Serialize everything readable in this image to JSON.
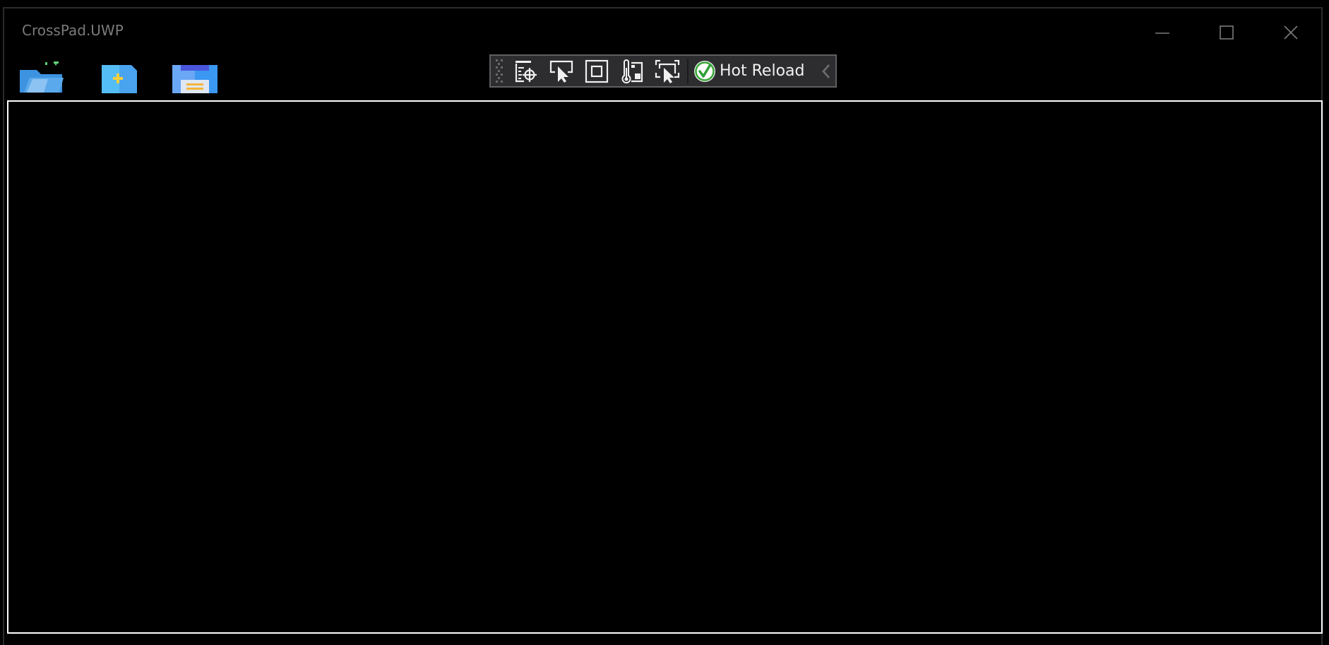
{
  "window": {
    "title": "CrossPad.UWP",
    "caption_buttons": [
      {
        "name": "minimize",
        "icon": "minimize-icon"
      },
      {
        "name": "maximize",
        "icon": "maximize-icon"
      },
      {
        "name": "close",
        "icon": "close-icon"
      }
    ]
  },
  "command_bar": {
    "buttons": [
      {
        "name": "open-file",
        "icon": "open-folder-icon"
      },
      {
        "name": "new-file",
        "icon": "new-file-icon"
      },
      {
        "name": "save-file",
        "icon": "save-icon"
      }
    ]
  },
  "dev_toolbar": {
    "tools": [
      {
        "name": "live-visual-tree",
        "icon": "select-element-target-icon"
      },
      {
        "name": "select-element",
        "icon": "select-pointer-icon"
      },
      {
        "name": "display-layout-adorners",
        "icon": "adorner-box-icon"
      },
      {
        "name": "track-focus",
        "icon": "thermometer-layout-icon"
      },
      {
        "name": "preview-selection",
        "icon": "preview-selection-icon"
      }
    ],
    "hot_reload": {
      "label": "Hot Reload",
      "status": "ok",
      "status_color": "#3aa83a"
    },
    "collapse_icon": "chevron-left-icon"
  },
  "editor": {
    "value": "",
    "placeholder": ""
  },
  "colors": {
    "background": "#000000",
    "title_text": "#7a7a7a",
    "editor_border": "#ffffff",
    "toolbar_bg": "#2d2d30",
    "toolbar_border": "#5f5f5f",
    "accent_blue": "#4aa3ee"
  }
}
